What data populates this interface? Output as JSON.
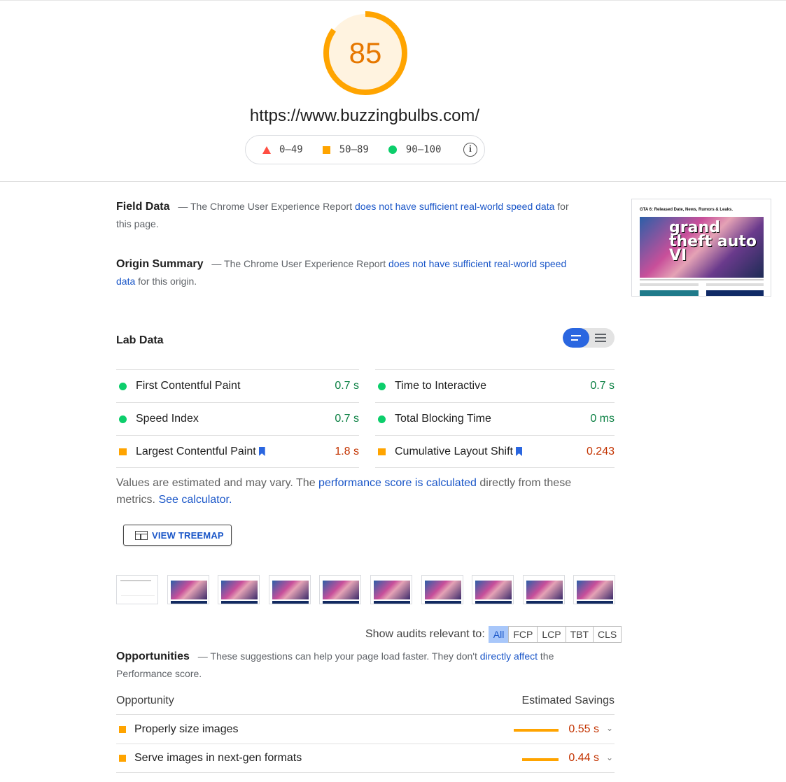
{
  "score": {
    "value": "85",
    "fraction": 0.85,
    "color": "#ffa400"
  },
  "url": "https://www.buzzingbulbs.com/",
  "legend": {
    "fail": "0–49",
    "average": "50–89",
    "pass": "90–100",
    "info_icon": "info-icon"
  },
  "field_data": {
    "heading": "Field Data",
    "dash": "—",
    "text_before": "The Chrome User Experience Report",
    "link": "does not have sufficient real-world speed data",
    "text_after": "for this page."
  },
  "origin_summary": {
    "heading": "Origin Summary",
    "dash": "—",
    "text_before": "The Chrome User Experience Report",
    "link": "does not have sufficient real-world speed data",
    "text_after": "for this origin."
  },
  "screenshot": {
    "title": "GTA 6: Released Date, News, Rumors & Leaks.",
    "logo_text": "grand theft auto VI"
  },
  "lab_data": {
    "title": "Lab Data",
    "metrics_left": [
      {
        "name": "First Contentful Paint",
        "value": "0.7 s",
        "status": "pass",
        "flag": false
      },
      {
        "name": "Speed Index",
        "value": "0.7 s",
        "status": "pass",
        "flag": false
      },
      {
        "name": "Largest Contentful Paint",
        "value": "1.8 s",
        "status": "average",
        "flag": true
      }
    ],
    "metrics_right": [
      {
        "name": "Time to Interactive",
        "value": "0.7 s",
        "status": "pass",
        "flag": false
      },
      {
        "name": "Total Blocking Time",
        "value": "0 ms",
        "status": "pass",
        "flag": false
      },
      {
        "name": "Cumulative Layout Shift",
        "value": "0.243",
        "status": "average",
        "flag": true
      }
    ]
  },
  "note": {
    "text1": "Values are estimated and may vary. The",
    "link1": "performance score is calculated",
    "text2": "directly from these metrics.",
    "link2": "See calculator."
  },
  "treemap_button": "VIEW TREEMAP",
  "filmstrip_frames": 10,
  "audit_filter": {
    "label": "Show audits relevant to:",
    "options": [
      "All",
      "FCP",
      "LCP",
      "TBT",
      "CLS"
    ],
    "selected": "All"
  },
  "opportunities": {
    "heading": "Opportunities",
    "dash": "—",
    "text_before": "These suggestions can help your page load faster. They don't",
    "link": "directly affect",
    "text_after": "the Performance score.",
    "col_opportunity": "Opportunity",
    "col_savings": "Estimated Savings",
    "items": [
      {
        "name": "Properly size images",
        "savings": "0.55 s",
        "status": "average"
      },
      {
        "name": "Serve images in next-gen formats",
        "savings": "0.44 s",
        "status": "average"
      }
    ]
  },
  "colors": {
    "pass": "#0cce6b",
    "average": "#ffa400",
    "fail": "#ff4e42",
    "link": "#1a56c8"
  }
}
